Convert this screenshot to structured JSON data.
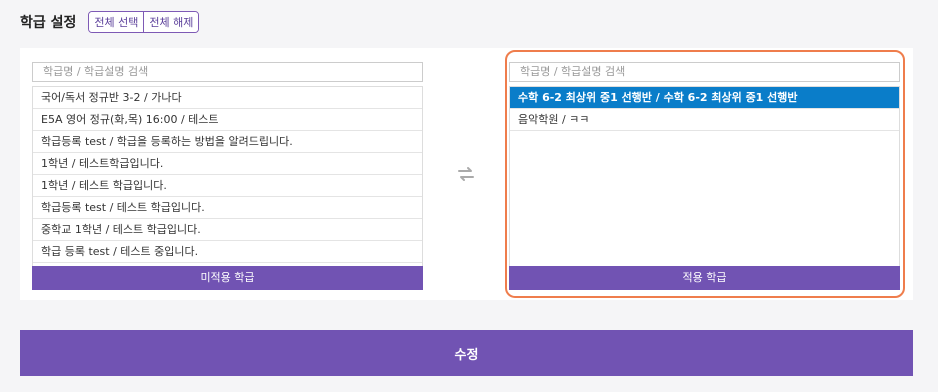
{
  "header": {
    "title": "학급 설정",
    "select_all": "전체 선택",
    "deselect_all": "전체 해제"
  },
  "left_panel": {
    "search_placeholder": "학급명 / 학급설명 검색",
    "items": [
      "국어/독서 정규반 3-2 / 가나다",
      "E5A 영어 정규(화,목) 16:00 / 테스트",
      "학급등록 test / 학급을 등록하는 방법을 알려드립니다.",
      "1학년 / 테스트학급입니다.",
      "1학년 / 테스트 학급입니다.",
      "학급등록 test / 테스트 학급입니다.",
      "중학교 1학년 / 테스트 학급입니다.",
      "학급 등록 test / 테스트 중입니다."
    ],
    "footer": "미적용 학급"
  },
  "right_panel": {
    "search_placeholder": "학급명 / 학급설명 검색",
    "items": [
      "수학 6-2 최상위 중1 선행반 / 수학 6-2 최상위 중1 선행반",
      "음악학원 / ㅋㅋ"
    ],
    "footer": "적용 학급"
  },
  "actions": {
    "submit": "수정"
  },
  "colors": {
    "accent": "#7153b3",
    "selected": "#0a7dc9",
    "highlight_frame": "#ef7d4c"
  }
}
